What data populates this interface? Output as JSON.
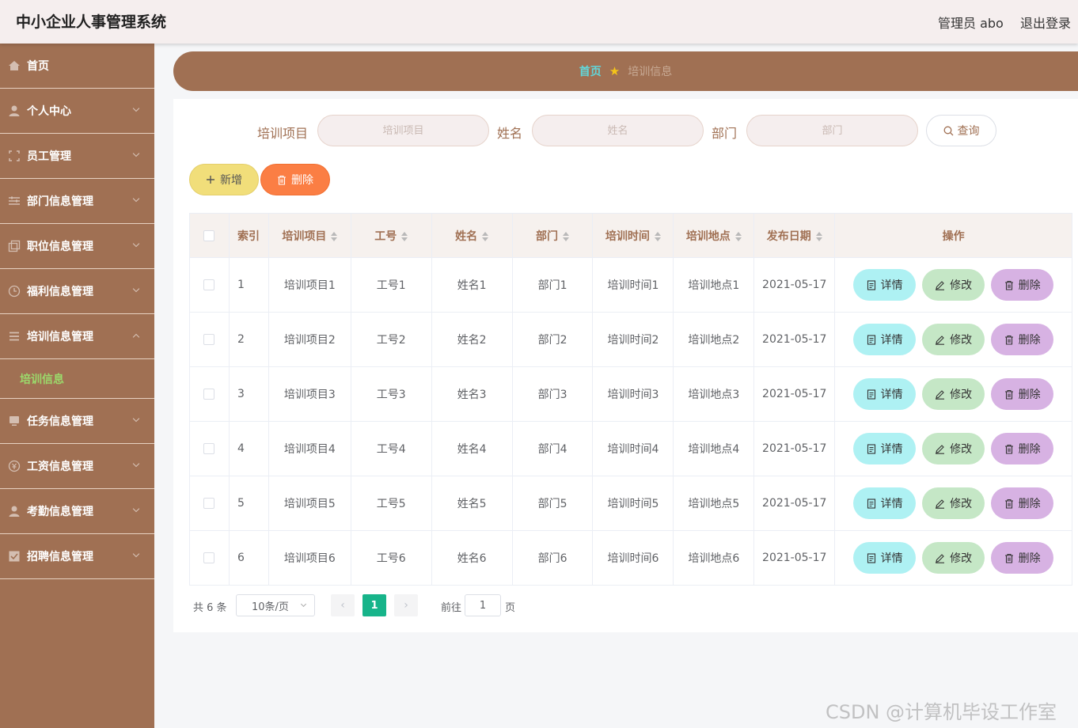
{
  "header": {
    "title": "中小企业人事管理系统",
    "admin": "管理员 abo",
    "logout": "退出登录"
  },
  "sidebar": {
    "items": [
      {
        "label": "首页",
        "icon": "home-icon",
        "expandable": false
      },
      {
        "label": "个人中心",
        "icon": "user-icon",
        "expandable": true
      },
      {
        "label": "员工管理",
        "icon": "frame-icon",
        "expandable": true
      },
      {
        "label": "部门信息管理",
        "icon": "sliders-icon",
        "expandable": true
      },
      {
        "label": "职位信息管理",
        "icon": "copy-icon",
        "expandable": true
      },
      {
        "label": "福利信息管理",
        "icon": "clock-icon",
        "expandable": true
      },
      {
        "label": "培训信息管理",
        "icon": "list-icon",
        "expandable": true,
        "expanded": true
      },
      {
        "label": "任务信息管理",
        "icon": "monitor-icon",
        "expandable": true
      },
      {
        "label": "工资信息管理",
        "icon": "coin-icon",
        "expandable": true
      },
      {
        "label": "考勤信息管理",
        "icon": "user-icon",
        "expandable": true
      },
      {
        "label": "招聘信息管理",
        "icon": "checkbox-icon",
        "expandable": true
      }
    ],
    "sub_active": "培训信息"
  },
  "breadcrumb": {
    "home": "首页",
    "current": "培训信息"
  },
  "search": {
    "fields": [
      {
        "label": "培训项目",
        "placeholder": "培训项目"
      },
      {
        "label": "姓名",
        "placeholder": "姓名"
      },
      {
        "label": "部门",
        "placeholder": "部门"
      }
    ],
    "query": "查询"
  },
  "actions": {
    "add": "新增",
    "delete": "删除"
  },
  "table": {
    "columns": [
      "索引",
      "培训项目",
      "工号",
      "姓名",
      "部门",
      "培训时间",
      "培训地点",
      "发布日期",
      "操作"
    ],
    "rows": [
      [
        "1",
        "培训项目1",
        "工号1",
        "姓名1",
        "部门1",
        "培训时间1",
        "培训地点1",
        "2021-05-17"
      ],
      [
        "2",
        "培训项目2",
        "工号2",
        "姓名2",
        "部门2",
        "培训时间2",
        "培训地点2",
        "2021-05-17"
      ],
      [
        "3",
        "培训项目3",
        "工号3",
        "姓名3",
        "部门3",
        "培训时间3",
        "培训地点3",
        "2021-05-17"
      ],
      [
        "4",
        "培训项目4",
        "工号4",
        "姓名4",
        "部门4",
        "培训时间4",
        "培训地点4",
        "2021-05-17"
      ],
      [
        "5",
        "培训项目5",
        "工号5",
        "姓名5",
        "部门5",
        "培训时间5",
        "培训地点5",
        "2021-05-17"
      ],
      [
        "6",
        "培训项目6",
        "工号6",
        "姓名6",
        "部门6",
        "培训时间6",
        "培训地点6",
        "2021-05-17"
      ]
    ],
    "row_actions": {
      "detail": "详情",
      "edit": "修改",
      "delete": "删除"
    }
  },
  "pagination": {
    "total": "共 6 条",
    "page_size": "10条/页",
    "current": "1",
    "goto_label": "前往",
    "goto_value": "1",
    "goto_suffix": "页"
  },
  "watermark": "CSDN @计算机毕设工作室",
  "colors": {
    "brand": "#a07053",
    "header_bg": "#f5eeee",
    "active_page": "#17b48a",
    "add_btn": "#f1de7a",
    "delete_btn": "#fb7e44",
    "detail_btn": "#aef1f3",
    "edit_btn": "#c5e7c6",
    "row_delete_btn": "#d7b2e3"
  }
}
